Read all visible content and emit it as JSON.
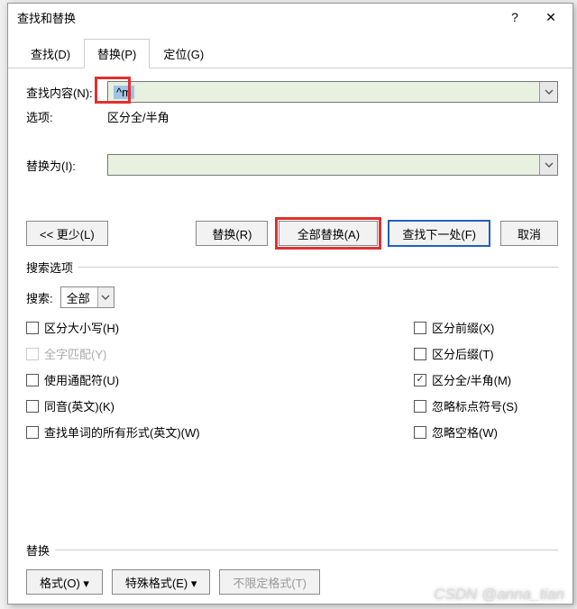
{
  "title": "查找和替换",
  "titlebar": {
    "help": "?",
    "close": "✕"
  },
  "tabs": {
    "find": "查找(D)",
    "replace": "替换(P)",
    "goto": "定位(G)"
  },
  "find": {
    "label": "查找内容(N):",
    "value": "^m",
    "options_label": "选项:",
    "options_value": "区分全/半角"
  },
  "repl": {
    "label": "替换为(I):",
    "value": ""
  },
  "buttons": {
    "less": "<< 更少(L)",
    "replace": "替换(R)",
    "replace_all": "全部替换(A)",
    "find_next": "查找下一处(F)",
    "cancel": "取消"
  },
  "search_opts": {
    "group": "搜索选项",
    "search_label": "搜索:",
    "search_value": "全部",
    "left": {
      "match_case": "区分大小写(H)",
      "whole_word": "全字匹配(Y)",
      "wildcards": "使用通配符(U)",
      "sounds_like": "同音(英文)(K)",
      "word_forms": "查找单词的所有形式(英文)(W)"
    },
    "right": {
      "prefix": "区分前缀(X)",
      "suffix": "区分后缀(T)",
      "fullhalf": "区分全/半角(M)",
      "punct": "忽略标点符号(S)",
      "space": "忽略空格(W)"
    }
  },
  "footer": {
    "group": "替换",
    "format": "格式(O) ▾",
    "special": "特殊格式(E) ▾",
    "noformat": "不限定格式(T)"
  },
  "watermark": "CSDN @anna_tian"
}
